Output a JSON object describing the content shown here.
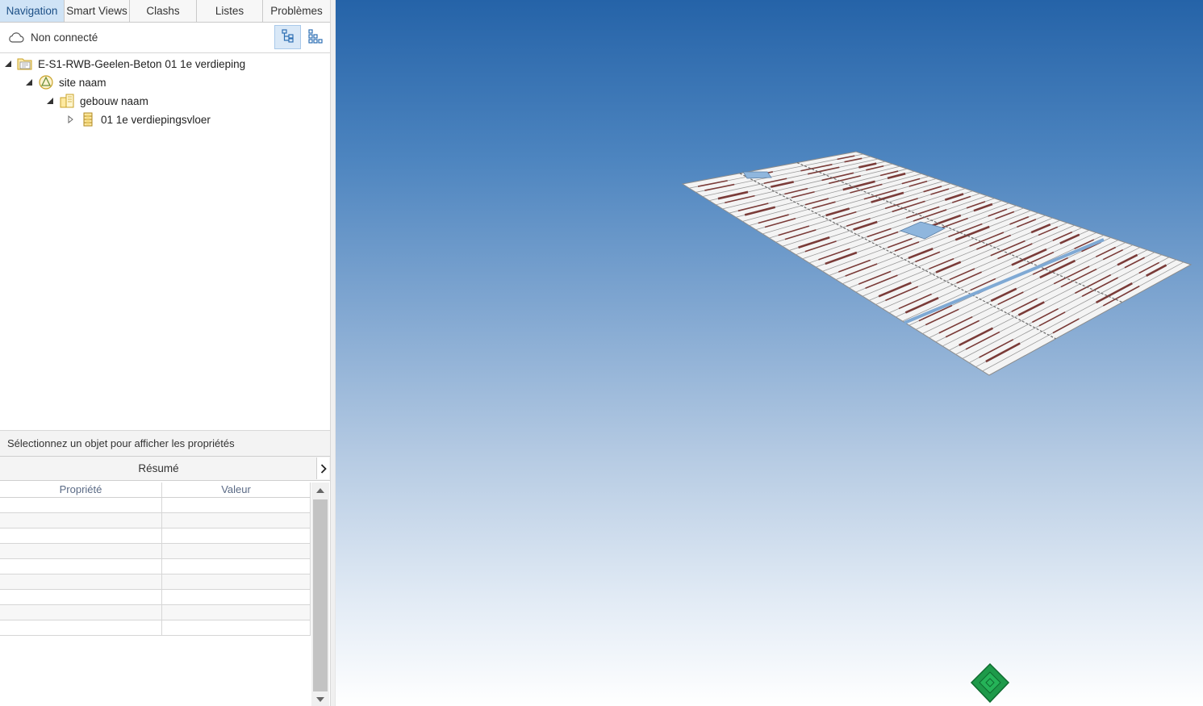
{
  "tabs": [
    {
      "label": "Navigation",
      "active": true
    },
    {
      "label": "Smart Views",
      "active": false
    },
    {
      "label": "Clashs",
      "active": false
    },
    {
      "label": "Listes",
      "active": false
    },
    {
      "label": "Problèmes",
      "active": false
    }
  ],
  "connection": {
    "status": "Non connecté",
    "icon": "cloud-icon"
  },
  "view_toggle": {
    "tree_icon": "tree-view-icon",
    "grid_icon": "grid-view-icon",
    "selected": "tree"
  },
  "tree": {
    "nodes": [
      {
        "label": "E-S1-RWB-Geelen-Beton 01 1e verdieping",
        "icon": "model-folder-icon",
        "expanded": true
      },
      {
        "label": "site naam",
        "icon": "site-icon",
        "expanded": true
      },
      {
        "label": "gebouw naam",
        "icon": "building-icon",
        "expanded": true
      },
      {
        "label": "01 1e verdiepingsvloer",
        "icon": "storey-icon",
        "expanded": false
      }
    ]
  },
  "properties": {
    "hint": "Sélectionnez un objet pour afficher les propriétés",
    "summary_label": "Résumé",
    "columns": [
      "Propriété",
      "Valeur"
    ]
  },
  "colors": {
    "accent": "#cfe3f6",
    "accent_text": "#1c4f86",
    "sky_top": "#2563a8",
    "sky_bottom": "#ffffff",
    "beam_color": "#7a3b38",
    "nav_cube": "#1e9a4a"
  }
}
